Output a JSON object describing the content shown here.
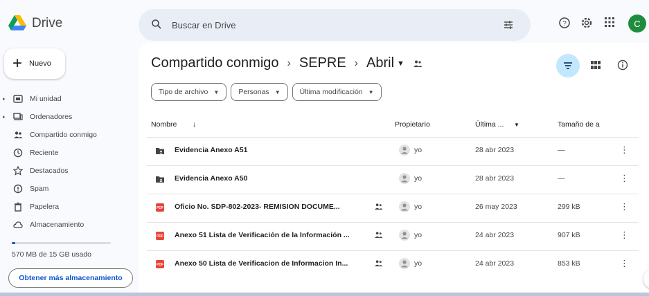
{
  "app": {
    "name": "Drive",
    "avatar_letter": "C",
    "brand_colors": [
      "#0f9d58",
      "#4285f4",
      "#fbbc04",
      "#ea4335"
    ]
  },
  "search": {
    "placeholder": "Buscar en Drive"
  },
  "sidebar": {
    "new_label": "Nuevo",
    "items": [
      {
        "label": "Mi unidad",
        "icon": "drive-icon"
      },
      {
        "label": "Ordenadores",
        "icon": "computer-icon"
      },
      {
        "label": "Compartido conmigo",
        "icon": "people-icon"
      },
      {
        "label": "Reciente",
        "icon": "clock-icon"
      },
      {
        "label": "Destacados",
        "icon": "star-icon"
      },
      {
        "label": "Spam",
        "icon": "spam-icon"
      },
      {
        "label": "Papelera",
        "icon": "trash-icon"
      },
      {
        "label": "Almacenamiento",
        "icon": "cloud-icon"
      }
    ],
    "storage": {
      "text": "570 MB de 15 GB usado",
      "used_fraction": 0.038
    },
    "more_storage_label": "Obtener más almacenamiento"
  },
  "breadcrumb": {
    "root": "Compartido conmigo",
    "middle": "SEPRE",
    "current": "Abril"
  },
  "filters": [
    {
      "label": "Tipo de archivo"
    },
    {
      "label": "Personas"
    },
    {
      "label": "Última modificación"
    }
  ],
  "table": {
    "headers": {
      "name": "Nombre",
      "owner": "Propietario",
      "modified": "Última ...",
      "size": "Tamaño de a"
    },
    "rows": [
      {
        "name": "Evidencia Anexo A51",
        "type": "folder",
        "shared": false,
        "owner": "yo",
        "modified": "28 abr 2023",
        "size": "—"
      },
      {
        "name": "Evidencia Anexo A50",
        "type": "folder",
        "shared": false,
        "owner": "yo",
        "modified": "28 abr 2023",
        "size": "—"
      },
      {
        "name": "Oficio No. SDP-802-2023- REMISION DOCUME...",
        "type": "pdf",
        "shared": true,
        "owner": "yo",
        "modified": "26 may 2023",
        "size": "299 kB"
      },
      {
        "name": "Anexo 51 Lista de Verificación de la Información ...",
        "type": "pdf",
        "shared": true,
        "owner": "yo",
        "modified": "24 abr 2023",
        "size": "907 kB"
      },
      {
        "name": "Anexo 50 Lista de Verificacion de Informacion In...",
        "type": "pdf",
        "shared": true,
        "owner": "yo",
        "modified": "24 abr 2023",
        "size": "853 kB"
      }
    ]
  }
}
